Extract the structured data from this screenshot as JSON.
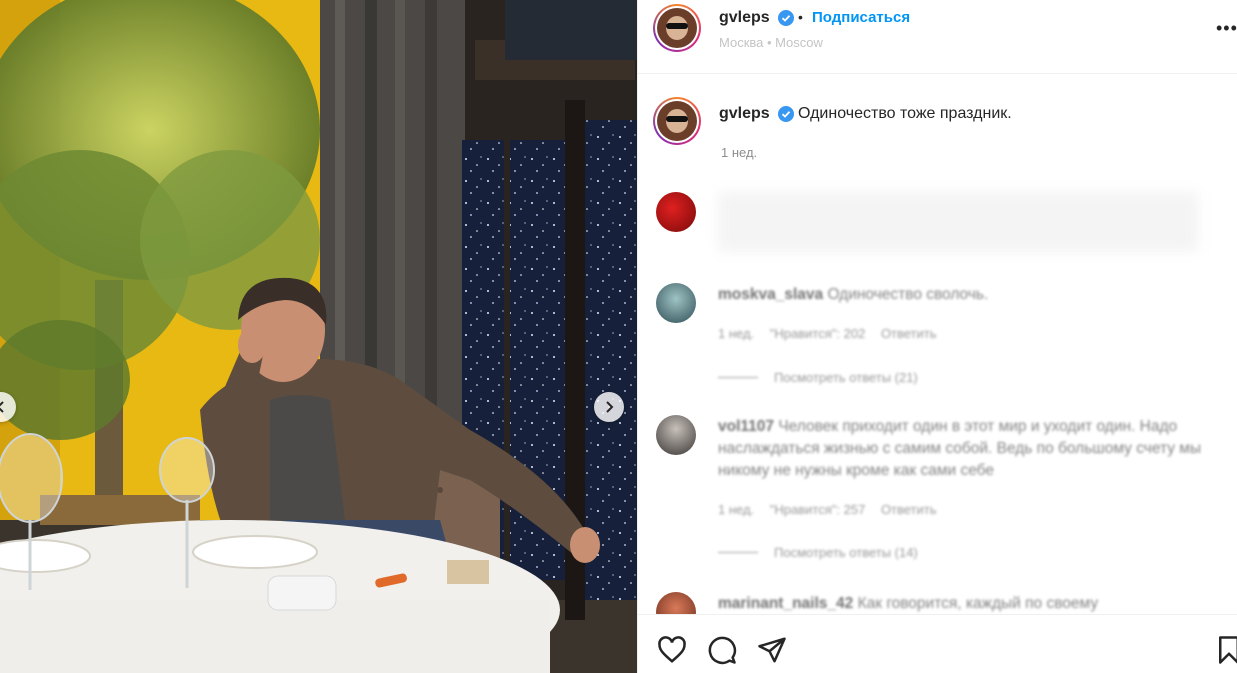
{
  "post": {
    "username": "gvleps",
    "follow_label": "Подписаться",
    "separator": "•",
    "location": "Москва • Moscow",
    "more": "•••"
  },
  "caption": {
    "username": "gvleps",
    "text": "Одиночество тоже праздник.",
    "time": "1 нед."
  },
  "comments": [
    {
      "username": "",
      "text": "",
      "meta": [],
      "replies": ""
    },
    {
      "username": "moskva_slava",
      "text": "Одиночество сволочь.",
      "meta": [
        "1 нед.",
        "\"Нравится\": 202",
        "Ответить"
      ],
      "replies": "Посмотреть ответы (21)"
    },
    {
      "username": "vol1107",
      "text": "Человек приходит один в этот мир и уходит один. Надо наслаждаться жизнью с самим собой. Ведь по большому счету мы никому не нужны кроме как сами себе",
      "meta": [
        "1 нед.",
        "\"Нравится\": 257",
        "Ответить"
      ],
      "replies": "Посмотреть ответы (14)"
    },
    {
      "username": "marinant_nails_42",
      "text": "Как говорится, каждый по своему",
      "meta": [],
      "replies": ""
    }
  ],
  "icons": {
    "verified": "verified-badge-icon",
    "like": "heart-icon",
    "comment": "comment-icon",
    "share": "paper-plane-icon",
    "save": "bookmark-icon",
    "next": "chevron-right-icon"
  },
  "colors": {
    "accent": "#0095f6",
    "verified": "#3897f0",
    "wall": "#f2c41a"
  }
}
